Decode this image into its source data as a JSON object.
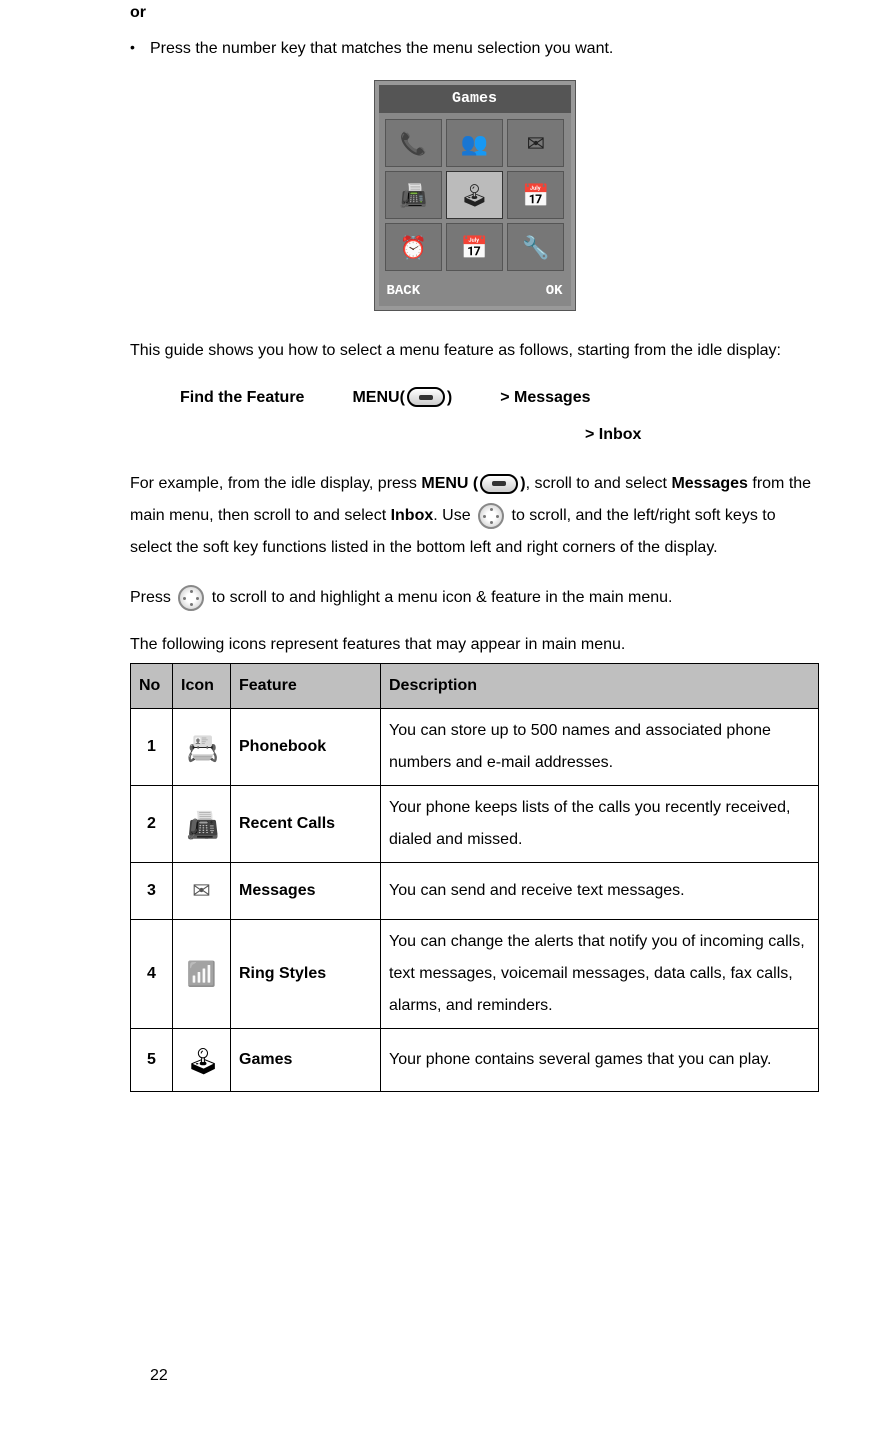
{
  "intro": {
    "or": "or",
    "bullet": "Press the number key that matches the menu selection you want."
  },
  "phone": {
    "title": "Games",
    "softkey_left": "BACK",
    "softkey_right": "OK",
    "grid_icons": [
      "📞",
      "👥",
      "✉",
      "📠",
      "🕹",
      "📅",
      "⏰",
      "📅",
      "🔧"
    ]
  },
  "para_guide": "This guide shows you how to select a menu feature as follows, starting from the idle display:",
  "find_feature": {
    "label": "Find the Feature",
    "menu_prefix": "MENU(",
    "menu_suffix": ")",
    "path1": "> Messages",
    "path2": "> Inbox"
  },
  "example": {
    "t1": "For example, from the idle display, press ",
    "t2_bold": "MENU (",
    "t3_bold": ")",
    "t4": ", scroll to and select ",
    "t5_bold": "Messages",
    "t6": " from the main menu, then scroll to and select ",
    "t7_bold": "Inbox",
    "t8": ". Use ",
    "t9": " to scroll, and the left/right soft keys to select the soft key functions listed in the bottom left and right corners of the display."
  },
  "press_para": {
    "t1": "Press ",
    "t2": " to scroll to and highlight a menu icon & feature in the main menu."
  },
  "table_intro": "The following icons represent features that may appear in main menu.",
  "table": {
    "headers": {
      "no": "No",
      "icon": "Icon",
      "feature": "Feature",
      "description": "Description"
    },
    "rows": [
      {
        "no": "1",
        "icon": "phonebook",
        "feature": "Phonebook",
        "description": "You can store up to 500 names and associated phone numbers and e-mail addresses."
      },
      {
        "no": "2",
        "icon": "recent",
        "feature": "Recent Calls",
        "description": "Your phone keeps lists of the calls you recently received, dialed and missed."
      },
      {
        "no": "3",
        "icon": "msg",
        "feature": "Messages",
        "description": "You can send and receive text messages."
      },
      {
        "no": "4",
        "icon": "ring",
        "feature": "Ring Styles",
        "description": "You can change the alerts that notify you of incoming calls, text messages, voicemail messages, data calls, fax calls, alarms, and reminders."
      },
      {
        "no": "5",
        "icon": "games",
        "feature": "Games",
        "description": "Your phone contains several games that you can play."
      }
    ]
  },
  "page_number": "22"
}
